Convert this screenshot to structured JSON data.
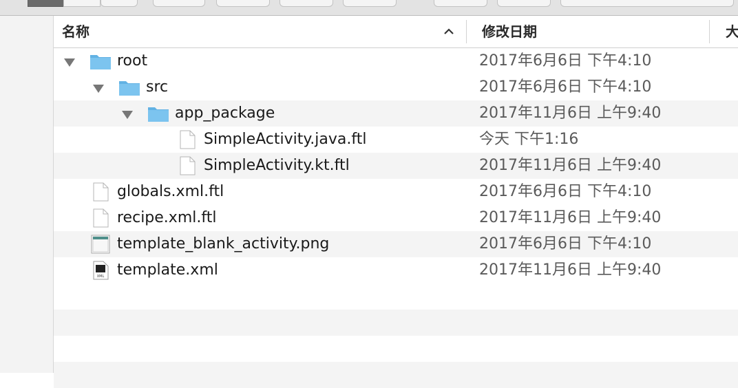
{
  "header": {
    "name_label": "名称",
    "date_label": "修改日期",
    "size_label": "大"
  },
  "files": [
    {
      "name": "root",
      "date": "2017年6月6日 下午4:10",
      "icon": "folder-icon",
      "expanded": true
    },
    {
      "name": "src",
      "date": "2017年6月6日 下午4:10",
      "icon": "folder-icon",
      "expanded": true
    },
    {
      "name": "app_package",
      "date": "2017年11月6日 上午9:40",
      "icon": "folder-icon",
      "expanded": true
    },
    {
      "name": "SimpleActivity.java.ftl",
      "date": "今天 下午1:16",
      "icon": "document-icon"
    },
    {
      "name": "SimpleActivity.kt.ftl",
      "date": "2017年11月6日 上午9:40",
      "icon": "document-icon"
    },
    {
      "name": "globals.xml.ftl",
      "date": "2017年6月6日 下午4:10",
      "icon": "document-icon"
    },
    {
      "name": "recipe.xml.ftl",
      "date": "2017年11月6日 上午9:40",
      "icon": "document-icon"
    },
    {
      "name": "template_blank_activity.png",
      "date": "2017年6月6日 下午4:10",
      "icon": "image-file-icon"
    },
    {
      "name": "template.xml",
      "date": "2017年11月6日 上午9:40",
      "icon": "xml-file-icon",
      "icon_text": "XML"
    }
  ],
  "colors": {
    "folder": "#7cc4ef",
    "folder_tab": "#62b2e4",
    "alt_row": "#f4f4f4"
  }
}
